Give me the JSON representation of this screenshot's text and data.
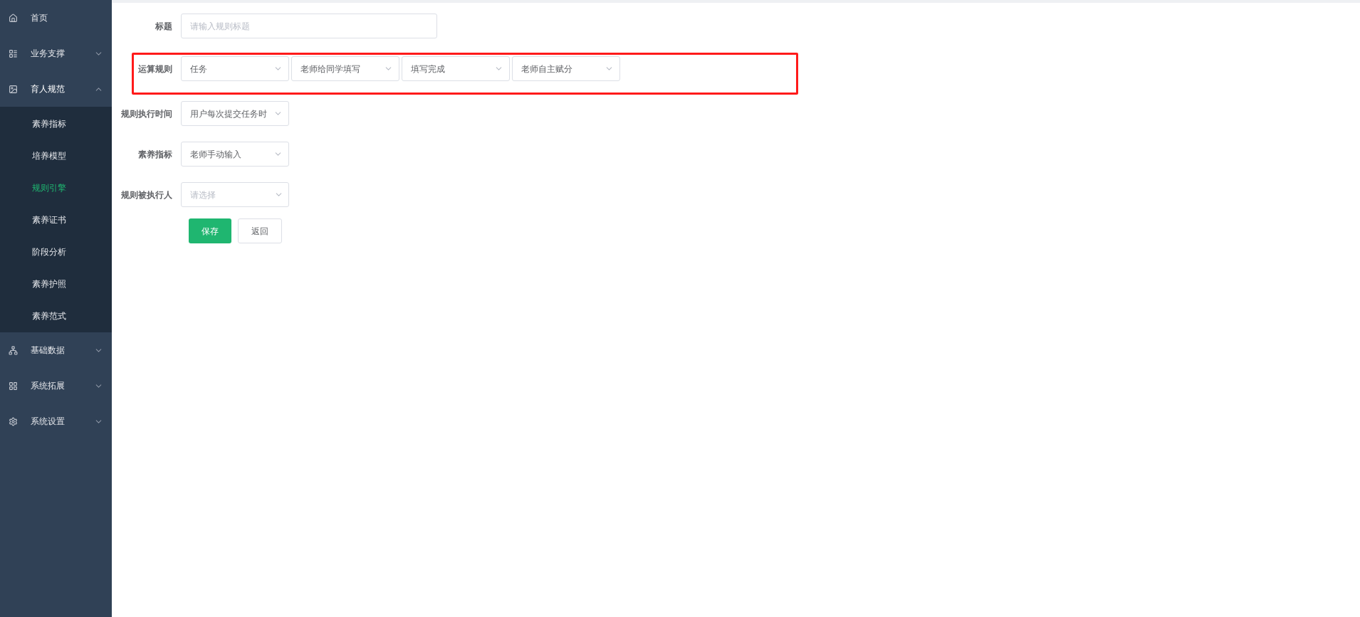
{
  "sidebar": {
    "items": [
      {
        "label": "首页",
        "kind": "link"
      },
      {
        "label": "业务支撑",
        "kind": "group",
        "expanded": false
      },
      {
        "label": "育人规范",
        "kind": "group",
        "expanded": true,
        "children": [
          {
            "label": "素养指标",
            "selected": false
          },
          {
            "label": "培养模型",
            "selected": false
          },
          {
            "label": "规则引擎",
            "selected": true
          },
          {
            "label": "素养证书",
            "selected": false
          },
          {
            "label": "阶段分析",
            "selected": false
          },
          {
            "label": "素养护照",
            "selected": false
          },
          {
            "label": "素养范式",
            "selected": false
          }
        ]
      },
      {
        "label": "基础数据",
        "kind": "group",
        "expanded": false
      },
      {
        "label": "系统拓展",
        "kind": "group",
        "expanded": false
      },
      {
        "label": "系统设置",
        "kind": "group",
        "expanded": false
      }
    ]
  },
  "form": {
    "fields": [
      {
        "label": "标题",
        "kind": "input",
        "highlighted": false,
        "controls": [
          {
            "placeholder": "请输入规则标题"
          }
        ]
      },
      {
        "label": "运算规则",
        "kind": "select",
        "highlighted": true,
        "controls": [
          {
            "value": "任务"
          },
          {
            "value": "老师给同学填写"
          },
          {
            "value": "填写完成"
          },
          {
            "value": "老师自主赋分"
          }
        ]
      },
      {
        "label": "规则执行时间",
        "kind": "select",
        "highlighted": false,
        "controls": [
          {
            "value": "用户每次提交任务时"
          }
        ]
      },
      {
        "label": "素养指标",
        "kind": "select",
        "highlighted": false,
        "controls": [
          {
            "value": "老师手动输入"
          }
        ]
      },
      {
        "label": "规则被执行人",
        "kind": "select",
        "highlighted": false,
        "controls": [
          {
            "placeholder": "请选择"
          }
        ]
      }
    ],
    "buttons": [
      {
        "label": "保存",
        "kind": "primary"
      },
      {
        "label": "返回",
        "kind": "default"
      }
    ]
  }
}
